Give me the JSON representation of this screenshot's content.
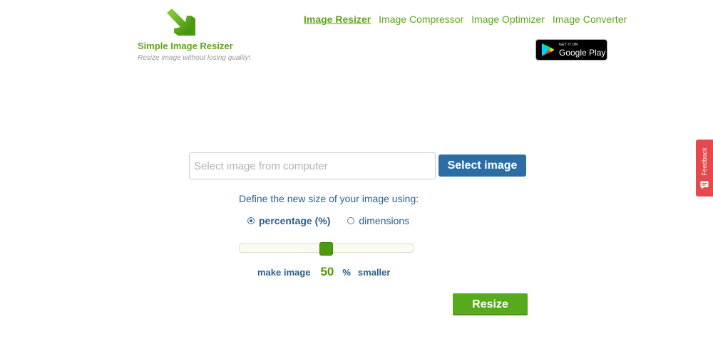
{
  "header": {
    "logo_icon": "resize-arrow-icon",
    "app_name": "Simple Image Resizer",
    "tagline": "Resize image without losing quality!"
  },
  "nav": {
    "items": [
      {
        "label": "Image Resizer",
        "active": true
      },
      {
        "label": "Image Compressor",
        "active": false
      },
      {
        "label": "Image Optimizer",
        "active": false
      },
      {
        "label": "Image Converter",
        "active": false
      }
    ]
  },
  "play_badge": {
    "small_text": "GET IT ON",
    "big_text": "Google Play",
    "icon": "google-play-icon"
  },
  "feedback": {
    "label": "Feedback",
    "icon": "chat-icon"
  },
  "upload": {
    "placeholder": "Select image from computer",
    "value": "",
    "button_label": "Select image"
  },
  "resize_options": {
    "instruction": "Define the new size of your image using:",
    "options": [
      {
        "label": "percentage (%)",
        "selected": true
      },
      {
        "label": "dimensions",
        "selected": false
      }
    ]
  },
  "slider": {
    "value_percent": 50
  },
  "size_text": {
    "prefix": "make image",
    "value": "50",
    "unit": "%",
    "suffix": "smaller"
  },
  "actions": {
    "resize_label": "Resize"
  },
  "colors": {
    "brand_green": "#5fa51a",
    "button_blue": "#2e6da4",
    "text_blue": "#2b5f8f",
    "feedback_red": "#e5494d"
  }
}
